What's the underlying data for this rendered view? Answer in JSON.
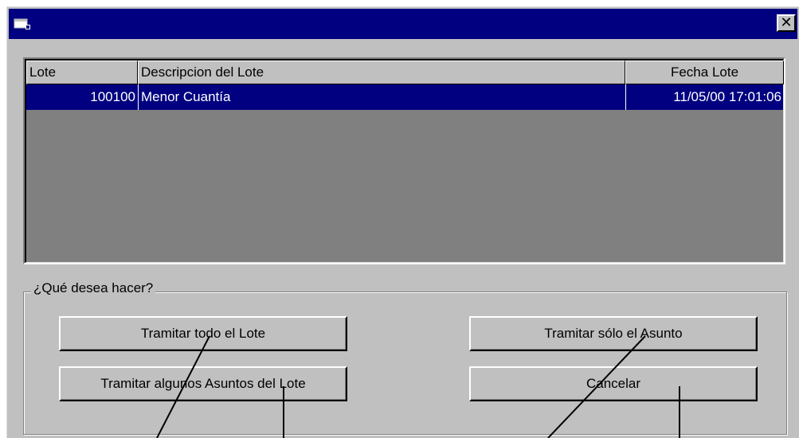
{
  "window": {
    "title": "",
    "icon": "app-icon",
    "close_label": "✕"
  },
  "lotes_table": {
    "columns": [
      "Lote",
      "Descripcion del Lote",
      "Fecha Lote"
    ],
    "rows": [
      {
        "lote": "100100",
        "descripcion": "Menor Cuantía",
        "fecha": "11/05/00 17:01:06"
      }
    ]
  },
  "options": {
    "group_label": "¿Qué desea hacer?",
    "tramitar_todo": "Tramitar todo el Lote",
    "tramitar_algunos": "Tramitar algunos Asuntos del Lote",
    "tramitar_solo": "Tramitar sólo el Asunto",
    "cancelar": "Cancelar"
  },
  "colors": {
    "titlebar": "#000080",
    "face": "#c0c0c0",
    "selection": "#000080",
    "list_background": "#808080"
  }
}
